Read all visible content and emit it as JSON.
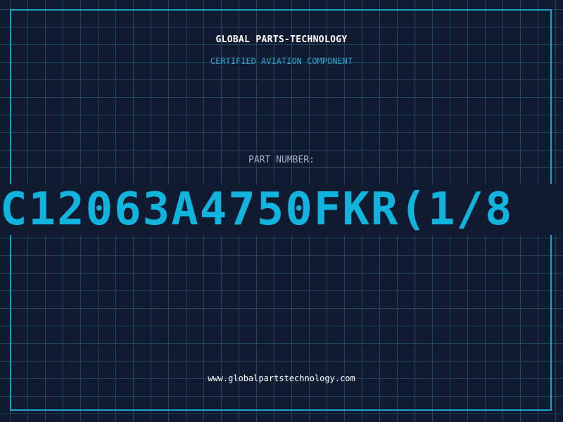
{
  "header": {
    "brand": "GLOBAL PARTS-TECHNOLOGY",
    "subtitle": "CERTIFIED AVIATION COMPONENT"
  },
  "part": {
    "label": "PART NUMBER:",
    "number": "C12063A4750FKR(1/8"
  },
  "footer": {
    "website": "www.globalpartstechnology.com"
  },
  "colors": {
    "background": "#101a30",
    "grid": "#1f4760",
    "frame": "#1aa3c4",
    "accent": "#10b4dc",
    "subtitle": "#27a9d3",
    "label": "#9fb0c4",
    "text": "#ffffff"
  }
}
